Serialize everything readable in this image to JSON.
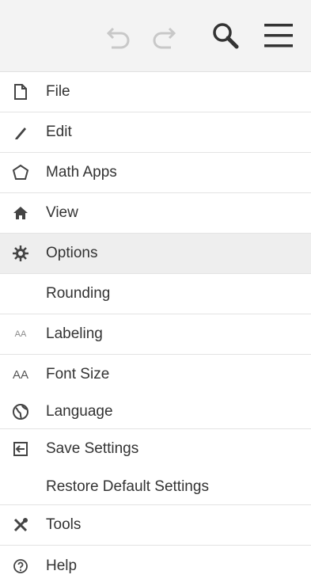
{
  "toolbar": {
    "undo_icon": "undo-icon",
    "redo_icon": "redo-icon",
    "search_icon": "search-icon",
    "menu_icon": "hamburger-menu-icon"
  },
  "menu": {
    "file": "File",
    "edit": "Edit",
    "math_apps": "Math Apps",
    "view": "View",
    "options": "Options",
    "rounding": "Rounding",
    "labeling": "Labeling",
    "font_size": "Font Size",
    "language": "Language",
    "save_settings": "Save Settings",
    "restore_defaults": "Restore Default Settings",
    "tools": "Tools",
    "help": "Help"
  },
  "icons": {
    "labeling_glyph": "AA",
    "font_size_glyph": "AA"
  },
  "colors": {
    "highlight": "#eeeeee",
    "toolbar_bg": "#f3f3f3",
    "icon_dim": "#c8c8c8",
    "icon_dark": "#333333"
  }
}
